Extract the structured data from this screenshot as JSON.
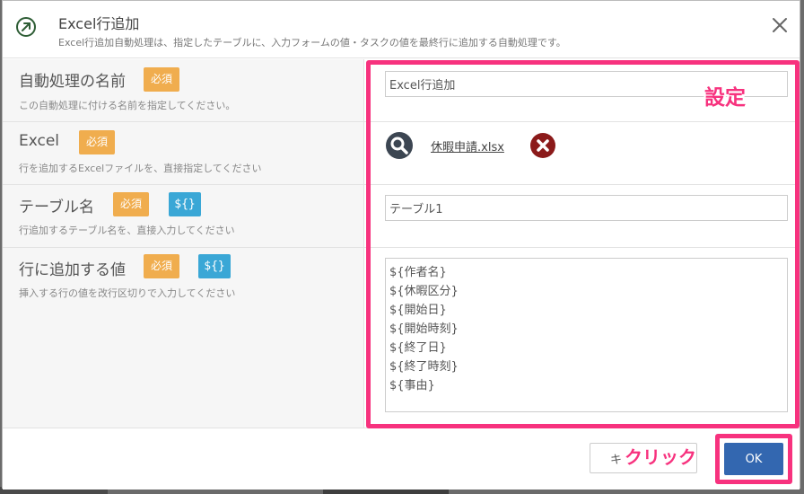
{
  "dialog": {
    "title": "Excel行追加",
    "subtitle": "Excel行追加自動処理は、指定したテーブルに、入力フォームの値・タスクの値を最終行に追加する自動処理です。"
  },
  "fields": {
    "name": {
      "label": "自動処理の名前",
      "badge": "必須",
      "description": "この自動処理に付ける名前を指定してください。",
      "value": "Excel行追加"
    },
    "excel": {
      "label": "Excel",
      "badge": "必須",
      "description": "行を追加するExcelファイルを、直接指定してください",
      "file_name": "休暇申請.xlsx"
    },
    "table": {
      "label": "テーブル名",
      "badge": "必須",
      "var_badge": "${}",
      "description": "行追加するテーブル名を、直接入力してください",
      "value": "テーブル1"
    },
    "values": {
      "label": "行に追加する値",
      "badge": "必須",
      "var_badge": "${}",
      "description": "挿入する行の値を改行区切りで入力してください",
      "value": "${作者名}\n${休暇区分}\n${開始日}\n${開始時刻}\n${終了日}\n${終了時刻}\n${事由}"
    }
  },
  "annotations": {
    "settings_label": "設定",
    "click_label": "クリック",
    "color": "#f7327e"
  },
  "footer": {
    "cancel_label": "キ",
    "ok_label": "OK"
  },
  "colors": {
    "required_badge": "#f0ad4e",
    "variable_badge": "#3aa7d6",
    "ok_button": "#3367b0",
    "remove_icon": "#8b1a1a",
    "search_icon": "#3c4652"
  }
}
